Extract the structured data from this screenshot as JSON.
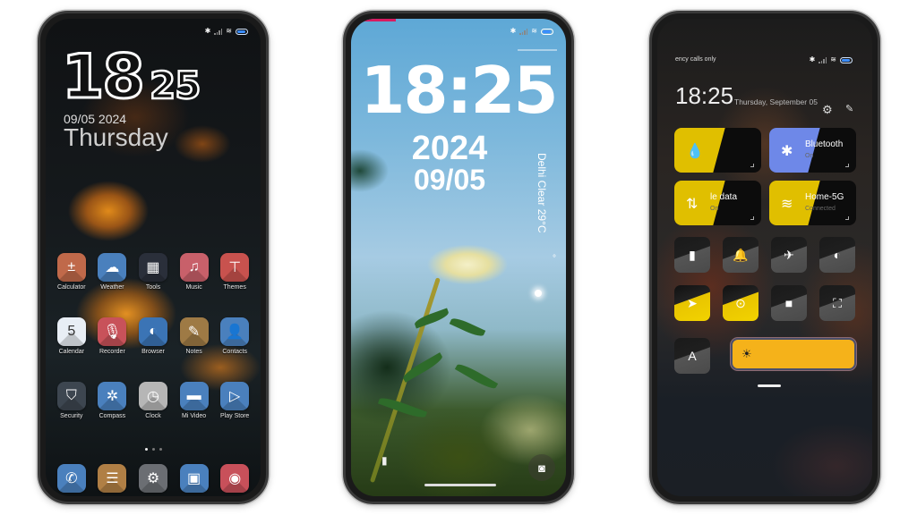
{
  "status_icons": [
    "bluetooth-icon",
    "signal-icon",
    "wifi-icon",
    "battery-icon"
  ],
  "home": {
    "clock": {
      "hour": "18",
      "minute": "25"
    },
    "date": "09/05 2024",
    "day": "Thursday",
    "apps": [
      {
        "label": "Calculator",
        "icon": "calculator-icon",
        "glyph": "±",
        "color": "#c0694a"
      },
      {
        "label": "Weather",
        "icon": "weather-icon",
        "glyph": "☁",
        "color": "#4a80bd"
      },
      {
        "label": "Tools",
        "icon": "tools-folder-icon",
        "glyph": "▦",
        "color": "#2a2f3a"
      },
      {
        "label": "Music",
        "icon": "music-icon",
        "glyph": "♫",
        "color": "#c8606a"
      },
      {
        "label": "Themes",
        "icon": "themes-icon",
        "glyph": "⊤",
        "color": "#c8524e"
      },
      {
        "label": "Calendar",
        "icon": "calendar-icon",
        "glyph": "5",
        "color": "#e8eef5"
      },
      {
        "label": "Recorder",
        "icon": "microphone-icon",
        "glyph": "🎙",
        "color": "#c8525a"
      },
      {
        "label": "Browser",
        "icon": "globe-icon",
        "glyph": "◐",
        "color": "#3b74b5"
      },
      {
        "label": "Notes",
        "icon": "notes-icon",
        "glyph": "✎",
        "color": "#9e7a45"
      },
      {
        "label": "Contacts",
        "icon": "contacts-icon",
        "glyph": "👤",
        "color": "#4a80bd"
      },
      {
        "label": "Security",
        "icon": "shield-icon",
        "glyph": "⛉",
        "color": "#3d4650"
      },
      {
        "label": "Compass",
        "icon": "compass-icon",
        "glyph": "✲",
        "color": "#4a80bd"
      },
      {
        "label": "Clock",
        "icon": "clock-icon",
        "glyph": "◷",
        "color": "#b6b6b6"
      },
      {
        "label": "Mi Video",
        "icon": "video-icon",
        "glyph": "▬",
        "color": "#4a80bd"
      },
      {
        "label": "Play Store",
        "icon": "play-store-icon",
        "glyph": "▷",
        "color": "#4a80bd"
      }
    ],
    "page_indicator": {
      "pages": 3,
      "current": 1
    },
    "dock": [
      {
        "label": "Phone",
        "icon": "phone-icon",
        "glyph": "✆",
        "color": "#4a80bd"
      },
      {
        "label": "Messages",
        "icon": "messages-icon",
        "glyph": "☰",
        "color": "#b07f45"
      },
      {
        "label": "Settings",
        "icon": "gear-icon",
        "glyph": "⚙",
        "color": "#6b6e73"
      },
      {
        "label": "Gallery",
        "icon": "gallery-icon",
        "glyph": "▣",
        "color": "#4a80bd"
      },
      {
        "label": "Camera",
        "icon": "camera-icon",
        "glyph": "◉",
        "color": "#c8505a"
      }
    ]
  },
  "lock": {
    "time": "18:25",
    "year": "2024",
    "month_day": "09/05",
    "weather": "Delhi Clear 29°C",
    "flashlight_glyph": "🔦",
    "camera_glyph": "📷"
  },
  "control_center": {
    "status_text": "ency calls only",
    "clock": "18:25",
    "date": "Thursday, September 05",
    "settings_glyph": "⚙",
    "edit_glyph": "✎",
    "big_tiles": [
      {
        "name": "",
        "sub": "",
        "icon": "data-saver-icon",
        "glyph": "💧",
        "color": "#e0bf00"
      },
      {
        "name": "Bluetooth",
        "sub": "On",
        "icon": "bluetooth-icon",
        "glyph": "✱",
        "color": "#6e88e8"
      },
      {
        "name": "le data",
        "sub": "On",
        "icon": "mobile-data-icon",
        "glyph": "⇅",
        "color": "#e0bf00"
      },
      {
        "name": "Home-5G",
        "sub": "Connected",
        "icon": "wifi-icon",
        "glyph": "≋",
        "color": "#e0bf00"
      }
    ],
    "small_tiles": [
      {
        "icon": "flashlight-icon",
        "glyph": "▮",
        "on": false
      },
      {
        "icon": "bell-icon",
        "glyph": "🔔",
        "on": false
      },
      {
        "icon": "airplane-icon",
        "glyph": "✈",
        "on": false
      },
      {
        "icon": "dark-mode-icon",
        "glyph": "◐",
        "on": false
      },
      {
        "icon": "location-icon",
        "glyph": "➤",
        "on": true
      },
      {
        "icon": "rotation-lock-icon",
        "glyph": "⊙",
        "on": true
      },
      {
        "icon": "screen-record-icon",
        "glyph": "■",
        "on": false
      },
      {
        "icon": "screenshot-icon",
        "glyph": "⛶",
        "on": false
      }
    ],
    "auto_brightness_label": "A",
    "brightness_glyph": "☀",
    "brightness_level": 1.0
  }
}
